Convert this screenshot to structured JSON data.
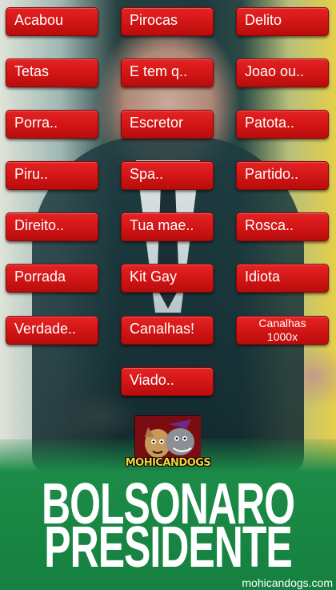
{
  "buttons": [
    {
      "label": "Acabou"
    },
    {
      "label": "Pirocas"
    },
    {
      "label": "Delito"
    },
    {
      "label": "Tetas"
    },
    {
      "label": "E tem q.."
    },
    {
      "label": "Joao ou.."
    },
    {
      "label": "Porra.."
    },
    {
      "label": "Escretor"
    },
    {
      "label": "Patota.."
    },
    {
      "label": "Piru.."
    },
    {
      "label": "Spa.."
    },
    {
      "label": "Partido.."
    },
    {
      "label": "Direito.."
    },
    {
      "label": "Tua mae.."
    },
    {
      "label": "Rosca.."
    },
    {
      "label": "Porrada"
    },
    {
      "label": "Kit Gay"
    },
    {
      "label": "Idiota"
    },
    {
      "label": "Verdade.."
    },
    {
      "label": "Canalhas!"
    },
    {
      "label_line1": "Canalhas",
      "label_line2": "1000x"
    },
    {
      "label": "Viado.."
    }
  ],
  "logo": {
    "text": "MOHICANDOGS"
  },
  "headline": {
    "line1": "BOLSONARO",
    "line2": "PRESIDENTE"
  },
  "footer": {
    "site": "mohicandogs.com"
  },
  "colors": {
    "button": "#d11414",
    "band": "#1d8b48",
    "logo_text": "#f2d43a"
  }
}
